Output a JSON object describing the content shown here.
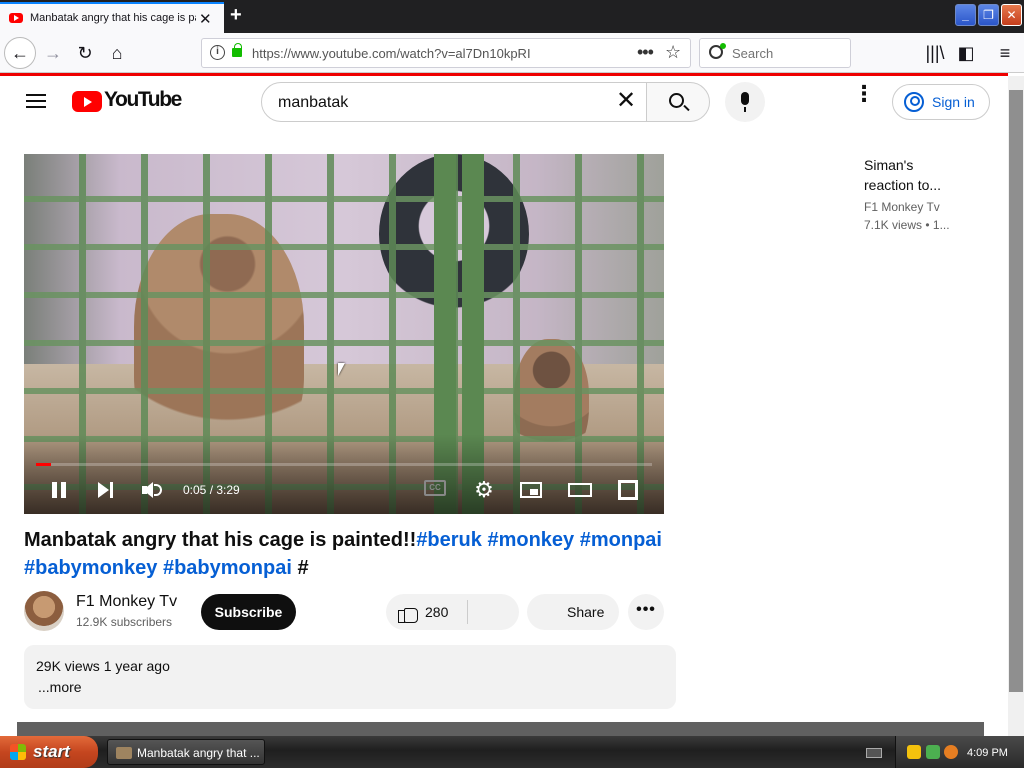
{
  "browser": {
    "tab_title": "Manbatak angry that his cage is painted!!",
    "tab_close": "✕",
    "new_tab": "+",
    "url": "https://www.youtube.com/watch?v=al7Dn10kpRI",
    "url_more": "•••",
    "bookmark_star": "☆",
    "search_placeholder": "Search",
    "back": "←",
    "forward": "→",
    "reload": "↻",
    "home": "⌂",
    "library": "|||\\",
    "sidebar": "◧",
    "menu": "≡",
    "window_min": "_",
    "window_max": "❐",
    "window_close": "✕",
    "accent_color": "#0a84ff",
    "icons": [
      "back-icon",
      "forward-icon",
      "reload-icon",
      "home-icon",
      "info-icon",
      "lock-icon",
      "bookmark-star-icon",
      "search-icon",
      "library-icon",
      "sidebar-icon",
      "menu-icon"
    ]
  },
  "youtube": {
    "logo_text": "YouTube",
    "search_value": "manbatak",
    "search_clear": "✕",
    "sign_in": "Sign in",
    "kebab": "⋮",
    "brand_color": "#ff0000",
    "link_color": "#065fd4"
  },
  "player": {
    "time": "0:05 / 3:29",
    "progress_fraction": 0.024,
    "settings_glyph": "⚙",
    "cc_label": "CC",
    "state": "playing"
  },
  "video": {
    "title_text": "Manbatak angry that his cage is painted!!",
    "tags": [
      "#beruk",
      "#monkey",
      "#monpai",
      "#babymonkey",
      "#babymonpai",
      "#"
    ],
    "channel_name": "F1 Monkey Tv",
    "subscribers": "12.9K subscribers",
    "subscribe_label": "Subscribe",
    "like_count": "280",
    "share_label": "Share",
    "more_actions": "•••",
    "views_and_date": "29K views  1 year ago",
    "more_label": "...more"
  },
  "recommendation": {
    "title": "Siman's reaction to...",
    "channel": "F1 Monkey Tv",
    "meta": "7.1K views  • 1..."
  },
  "taskbar": {
    "start_label": "start",
    "task_label": "Manbatak angry that ...",
    "clock": "4:09 PM"
  }
}
